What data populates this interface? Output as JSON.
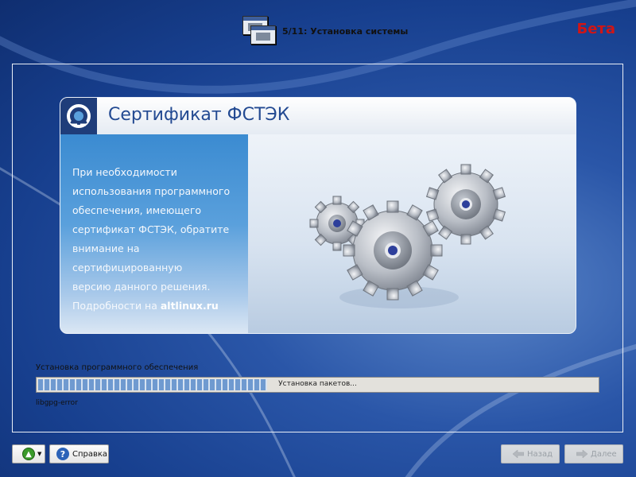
{
  "header": {
    "step_title": "5/11: Установка системы",
    "beta_label": "Бета"
  },
  "card": {
    "title": "Сертификат ФСТЭК",
    "text_lines": [
      "При необходимости",
      "использования программного",
      "обеспечения, имеющего",
      "сертификат ФСТЭК, обратите",
      "внимание на сертифицированную",
      "версию данного решения."
    ],
    "details_prefix": "Подробности на ",
    "details_link": "altlinux.ru"
  },
  "progress": {
    "label": "Установка программного обеспечения",
    "status_text": "Установка пакетов...",
    "value_fraction": 0.41,
    "current_package": "libgpg-error"
  },
  "buttons": {
    "help": "Справка",
    "back": "Назад",
    "next": "Далее"
  },
  "colors": {
    "beta": "#d11515",
    "title": "#234a92",
    "progress_fill": "#6f9ad0",
    "background": "#1f4a9e"
  },
  "icons": {
    "step": "installer-window-icon",
    "logo": "altlinux-logo-icon",
    "gears": "gears-illustration",
    "menu": "green-arrow-menu-icon",
    "help": "help-question-icon",
    "back": "arrow-left-icon",
    "next": "arrow-right-icon"
  }
}
